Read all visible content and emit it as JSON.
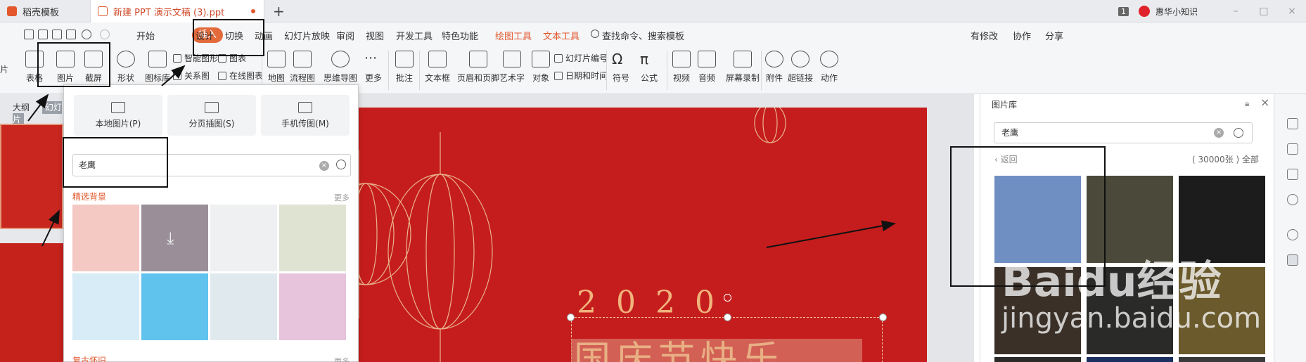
{
  "tabs": [
    {
      "label": "稻壳模板",
      "color": "#e2572b"
    },
    {
      "label": "新建 PPT 演示文稿 (3).ppt",
      "color": "#e2572b"
    }
  ],
  "titlebar": {
    "page_badge": "1",
    "user_name": "惠华小知识",
    "win_controls": [
      "–",
      "□",
      "×"
    ]
  },
  "menu": {
    "items": [
      "开始",
      "插入",
      "设计",
      "切换",
      "动画",
      "幻灯片放映",
      "审阅",
      "视图",
      "开发工具",
      "特色功能",
      "绘图工具",
      "文本工具"
    ],
    "search": "查找命令、搜索模板",
    "right": [
      "有修改",
      "协作",
      "分享"
    ]
  },
  "ribbon": {
    "big": [
      "表格",
      "图片",
      "截屏",
      "形状",
      "图标库",
      "地图",
      "流程图",
      "思维导图",
      "更多",
      "批注",
      "文本框",
      "页眉和页脚",
      "艺术字",
      "对象",
      "符号",
      "公式",
      "视频",
      "音频",
      "屏幕录制",
      "附件",
      "超链接",
      "动作"
    ],
    "small": [
      "智能图形",
      "图表",
      "关系图",
      "在线图表",
      "幻灯片编号",
      "日期和时间"
    ],
    "left_cut": "片"
  },
  "leftpane": {
    "tabs": [
      "大纲",
      "幻灯片"
    ]
  },
  "dropdown": {
    "sources": [
      "本地图片(P)",
      "分页插图(S)",
      "手机传图(M)"
    ],
    "search_value": "老鹰",
    "section1": "精选背景",
    "section2": "复古怀旧",
    "more": "更多",
    "thumb_colors": [
      "#f4c9c4",
      "#9a8f98",
      "#eef0f1",
      "#dfe3d2",
      "#d7ecf6",
      "#5fc3ee",
      "#dfe9ee",
      "#e7c3dc"
    ]
  },
  "slide": {
    "year": "2020",
    "title": "国庆节快乐",
    "bg_color": "#c51d1d",
    "accent_color": "#f1b37c"
  },
  "rightpane": {
    "title": "图片库",
    "search_value": "老鹰",
    "back": "返回",
    "count": "( 30000张 )",
    "all": "全部",
    "eagle_colors": [
      "#6f8fc2",
      "#4b4a3a",
      "#1c1c1c",
      "#3a3028",
      "#2a2a28",
      "#6a5a2c",
      "#2a2a28",
      "#1b3060",
      "#3a3a3a"
    ]
  },
  "watermark": {
    "line1": "Baidu经验",
    "line2": "jingyan.baidu.com"
  }
}
